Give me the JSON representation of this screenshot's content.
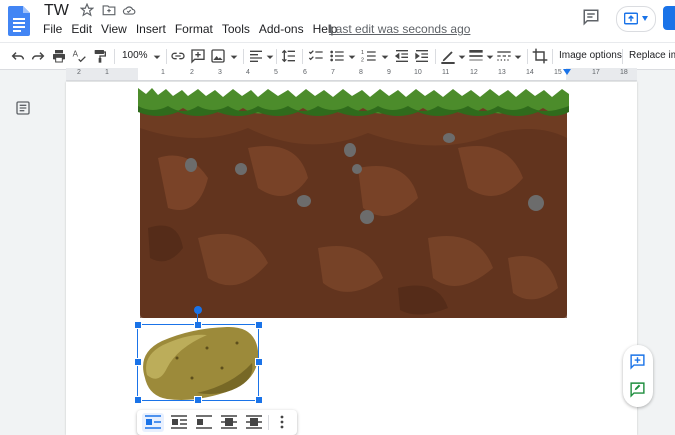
{
  "app": {
    "doc_title": "TW",
    "last_edit": "Last edit was seconds ago"
  },
  "menu": [
    "File",
    "Edit",
    "View",
    "Insert",
    "Format",
    "Tools",
    "Add-ons",
    "Help"
  ],
  "toolbar": {
    "zoom": "100%",
    "image_options": "Image options",
    "replace_image": "Replace image"
  },
  "ruler": {
    "ticks": [
      "2",
      "1",
      "1",
      "2",
      "3",
      "4",
      "5",
      "6",
      "7",
      "8",
      "9",
      "10",
      "11",
      "12",
      "13",
      "14",
      "15",
      "16",
      "17",
      "18"
    ]
  },
  "colors": {
    "accent": "#1a73e8",
    "soil": "#6b3a1f",
    "grass": "#4c8c2b",
    "potato": "#9c8a3a"
  },
  "icons": {
    "undo": "undo-icon",
    "redo": "redo-icon",
    "print": "print-icon",
    "spellcheck": "spellcheck-icon",
    "paint_format": "paint-format-icon",
    "link": "link-icon",
    "comment": "add-comment-icon",
    "image": "insert-image-icon",
    "align": "align-left-icon",
    "line_spacing": "line-spacing-icon",
    "checklist": "checklist-icon",
    "bullets": "bulleted-list-icon",
    "numbered": "numbered-list-icon",
    "indent_less": "decrease-indent-icon",
    "indent_more": "increase-indent-icon",
    "border_color": "border-color-icon",
    "border_weight": "border-weight-icon",
    "border_dash": "border-dash-icon",
    "crop": "crop-icon"
  }
}
